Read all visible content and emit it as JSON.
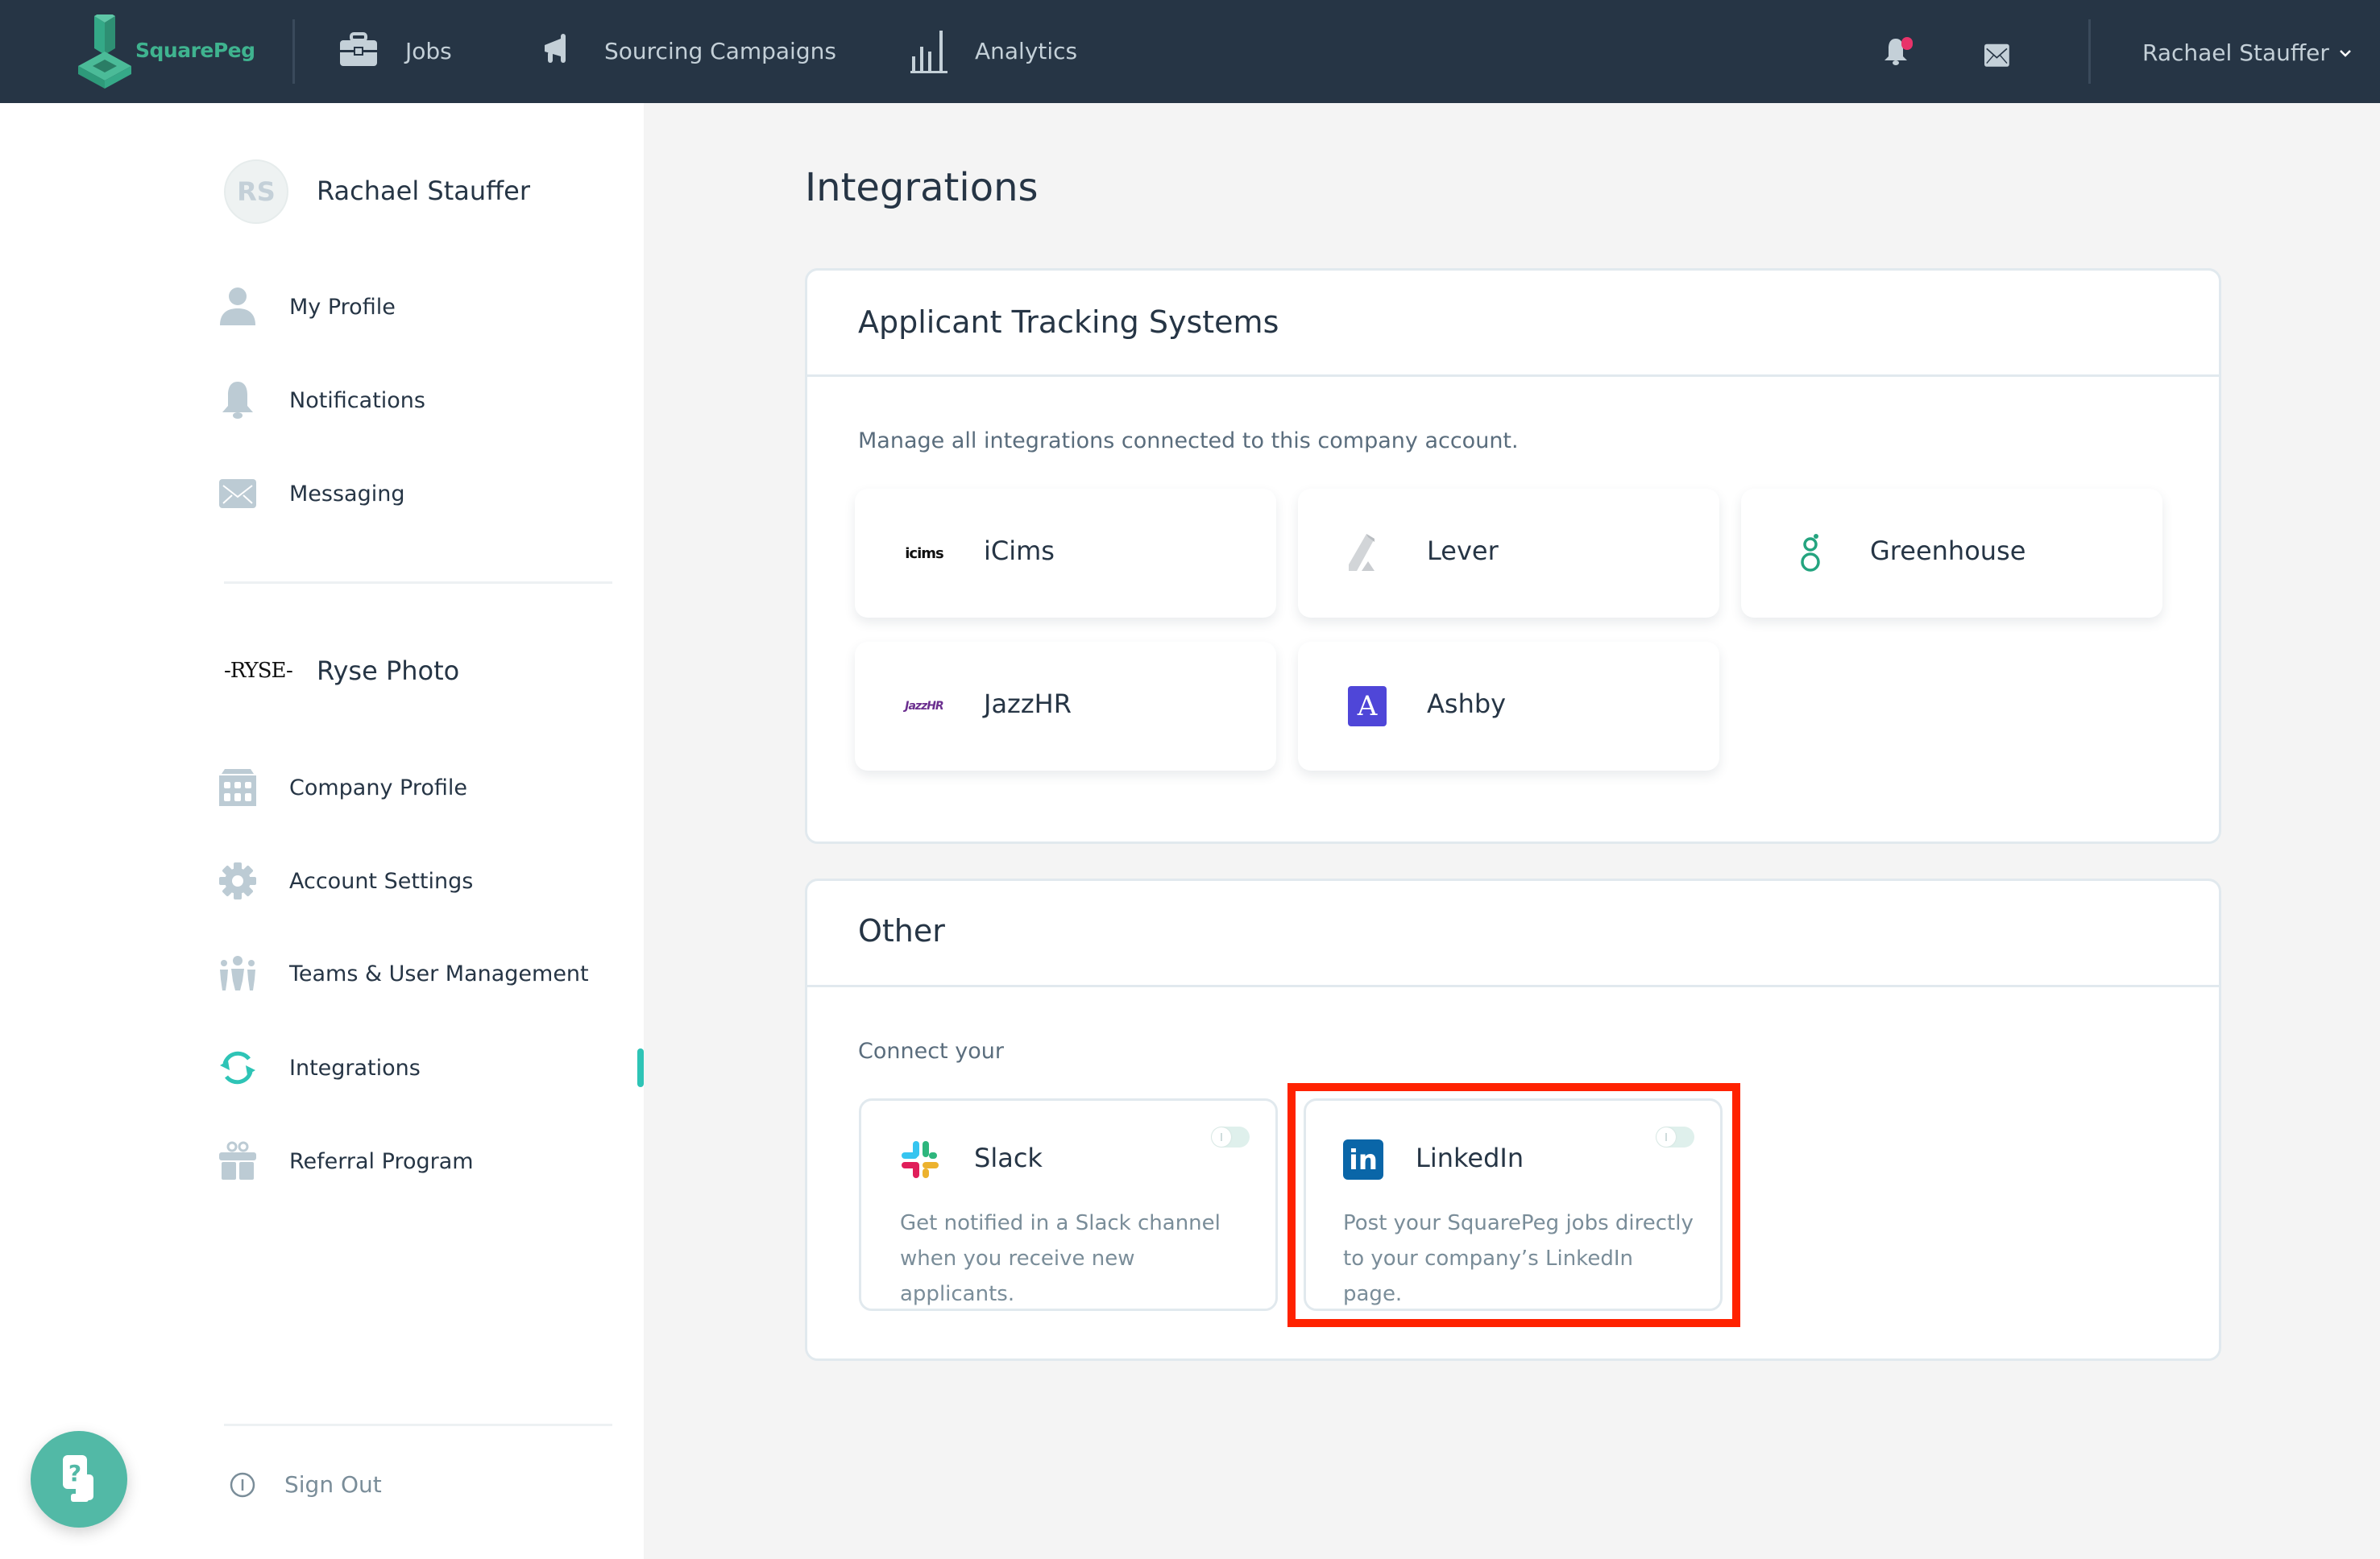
{
  "topbar": {
    "brand": "SquarePeg",
    "nav": [
      {
        "label": "Jobs",
        "icon": "briefcase-icon"
      },
      {
        "label": "Sourcing Campaigns",
        "icon": "megaphone-icon"
      },
      {
        "label": "Analytics",
        "icon": "bar-chart-icon"
      }
    ],
    "user_name": "Rachael Stauffer",
    "notification_dot_color": "#e8336a"
  },
  "sidebar": {
    "user": {
      "initials": "RS",
      "name": "Rachael Stauffer"
    },
    "personal_items": [
      {
        "label": "My Profile",
        "icon": "user-icon"
      },
      {
        "label": "Notifications",
        "icon": "bell-icon"
      },
      {
        "label": "Messaging",
        "icon": "envelope-icon"
      }
    ],
    "company": {
      "logo_text": "-RYSE-",
      "name": "Ryse Photo"
    },
    "company_items": [
      {
        "label": "Company Profile",
        "icon": "building-icon"
      },
      {
        "label": "Account Settings",
        "icon": "gear-icon"
      },
      {
        "label": "Teams & User Management",
        "icon": "team-icon"
      },
      {
        "label": "Integrations",
        "icon": "sync-icon",
        "active": true
      },
      {
        "label": "Referral Program",
        "icon": "gift-icon"
      }
    ],
    "sign_out": "Sign Out",
    "accent_color": "#2ec4b6"
  },
  "main": {
    "title": "Integrations",
    "ats": {
      "heading": "Applicant Tracking Systems",
      "description": "Manage all integrations connected to this company account.",
      "providers": [
        {
          "name": "iCims",
          "logo_text": "icims"
        },
        {
          "name": "Lever"
        },
        {
          "name": "Greenhouse"
        },
        {
          "name": "JazzHR",
          "logo_text": "JazzHR"
        },
        {
          "name": "Ashby",
          "logo_text": "A"
        }
      ]
    },
    "other": {
      "heading": "Other",
      "description": "Connect your",
      "apps": [
        {
          "name": "Slack",
          "description": "Get notified in a Slack channel when you receive new applicants.",
          "enabled": false
        },
        {
          "name": "LinkedIn",
          "description": "Post your SquarePeg jobs directly to your company’s LinkedIn page.",
          "enabled": false,
          "highlighted": true,
          "logo_text": "in"
        }
      ]
    }
  },
  "help_button": {
    "icon": "help-chat-icon"
  },
  "highlight_color": "#ff2200"
}
